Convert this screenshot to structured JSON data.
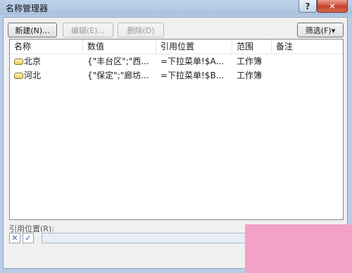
{
  "window": {
    "title": "名称管理器"
  },
  "toolbar": {
    "new_label": "新建(N)...",
    "edit_label": "编辑(E)...",
    "delete_label": "删除(D)",
    "filter_label": "筛选(F)▾"
  },
  "table": {
    "headers": [
      "名称",
      "数值",
      "引用位置",
      "范围",
      "备注"
    ],
    "rows": [
      {
        "name": "北京",
        "value": "{\"丰台区\";\"西...",
        "ref": "=下拉菜单!$A...",
        "scope": "工作簿",
        "note": ""
      },
      {
        "name": "河北",
        "value": "{\"保定\";\"廊坊...",
        "ref": "=下拉菜单!$B...",
        "scope": "工作簿",
        "note": ""
      }
    ]
  },
  "reference": {
    "label": "引用位置(R):",
    "cancel_icon": "✕",
    "confirm_icon": "✓",
    "value": ""
  },
  "watermark": {
    "text": ""
  },
  "colors": {
    "close_button": "#c7412c",
    "watermark": "#f3a1c6"
  },
  "icons": [
    "help-icon",
    "close-icon",
    "name-icon",
    "cancel-icon",
    "confirm-icon"
  ]
}
